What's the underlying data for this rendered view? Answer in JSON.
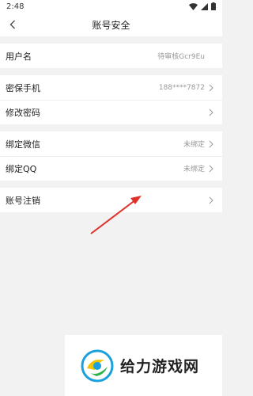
{
  "status": {
    "time": "2:48"
  },
  "header": {
    "title": "账号安全"
  },
  "sections": [
    [
      {
        "label": "用户名",
        "value": "待审核Gcr9Eu",
        "chevron": false
      }
    ],
    [
      {
        "label": "密保手机",
        "value": "188****7872",
        "chevron": true
      },
      {
        "label": "修改密码",
        "value": "",
        "chevron": true
      }
    ],
    [
      {
        "label": "绑定微信",
        "value": "未绑定",
        "chevron": true
      },
      {
        "label": "绑定QQ",
        "value": "未绑定",
        "chevron": true
      }
    ],
    [
      {
        "label": "账号注销",
        "value": "",
        "chevron": true
      }
    ]
  ],
  "watermark": {
    "text": "给力游戏网"
  },
  "colors": {
    "annotation_arrow": "#e0312b",
    "background": "#f2f2f2"
  }
}
